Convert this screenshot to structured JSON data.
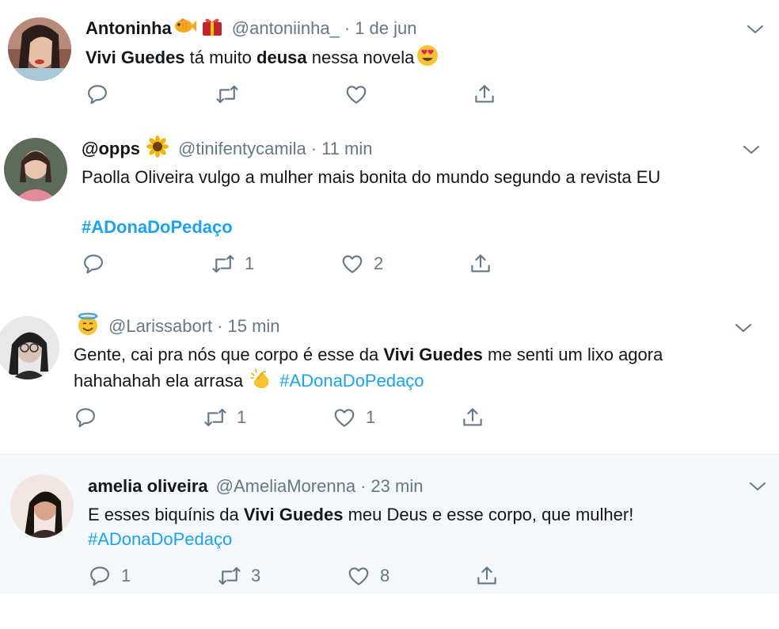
{
  "tweets": [
    {
      "name": "Antoninha",
      "handle": "@antoniinha_",
      "dot": "·",
      "time": "1 de jun",
      "name_emojis": [
        "fish-emoji",
        "gift-emoji"
      ],
      "text": {
        "b1": "Vivi Guedes",
        "t1": " tá muito ",
        "b2": "deusa",
        "t2": " nessa novela"
      },
      "text_emoji": "heart-eyes-emoji",
      "replies": "",
      "retweets": "",
      "likes": ""
    },
    {
      "name": "@opps",
      "handle": "@tinifentycamila",
      "dot": "·",
      "time": "11 min",
      "name_emojis": [
        "sunflower-emoji"
      ],
      "text": {
        "line1": "Paolla Oliveira vulgo a mulher mais bonita do mundo segundo a revista EU",
        "hashtag": "#ADonaDoPedaço"
      },
      "replies": "",
      "retweets": "1",
      "likes": "2"
    },
    {
      "name": "",
      "handle": "@Larissabort",
      "dot": "·",
      "time": "15 min",
      "name_emojis": [
        "halo-smile-emoji"
      ],
      "text": {
        "t1": "Gente, cai pra nós que corpo é esse da ",
        "b1": "Vivi Guedes",
        "t2": " me senti um lixo agora",
        "t3": "hahahahah ela arrasa ",
        "hashtag": "#ADonaDoPedaço"
      },
      "text_emoji": "clapping-hands-emoji",
      "replies": "",
      "retweets": "1",
      "likes": "1"
    },
    {
      "name": "amelia oliveira",
      "handle": "@AmeliaMorenna",
      "dot": "·",
      "time": "23 min",
      "name_emojis": [],
      "text": {
        "t1": "E esses biquínis da ",
        "b1": "Vivi Guedes",
        "t2": " meu Deus e esse corpo, que mulher!",
        "hashtag": "#ADonaDoPedaço"
      },
      "replies": "1",
      "retweets": "3",
      "likes": "8"
    }
  ],
  "colors": {
    "text": "#14171a",
    "secondary": "#657786",
    "hashtag": "#1da1f2",
    "highlight_bg": "#f5f8fa",
    "divider": "#e6ecf0"
  },
  "icons": [
    "reply-icon",
    "retweet-icon",
    "like-icon",
    "share-icon",
    "chevron-down-icon"
  ]
}
